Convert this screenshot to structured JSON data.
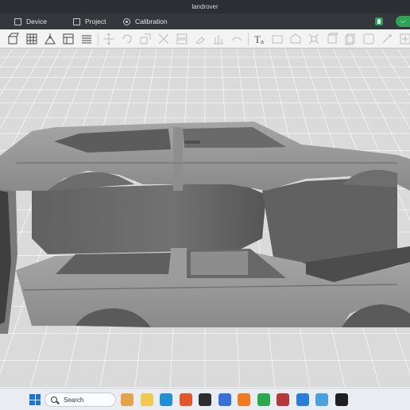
{
  "window": {
    "title": "landrover"
  },
  "menu": {
    "items": [
      {
        "label": "Device",
        "icon": "monitor-icon"
      },
      {
        "label": "Project",
        "icon": "folder-icon"
      },
      {
        "label": "Calibration",
        "icon": "gear-icon"
      }
    ],
    "right_pill_glyph": "⌵"
  },
  "toolbar": {
    "icons": [
      "add-object-icon",
      "grid-icon",
      "import-icon",
      "layout-icon",
      "slice-icon",
      "move-icon",
      "rotate-icon",
      "scale-icon",
      "cut-icon",
      "split-icon",
      "paint-icon",
      "support-icon",
      "seam-icon",
      "text-icon",
      "measure-icon",
      "assembly-icon",
      "arrange-icon",
      "orient-icon",
      "copy-icon",
      "plate-icon",
      "variable-layer-icon",
      "more-icon"
    ]
  },
  "taskbar": {
    "search_label": "Search",
    "apps": [
      "widgets-icon",
      "files-icon",
      "edge-icon",
      "office-icon",
      "terminal-icon",
      "vpn-icon",
      "firefox-icon",
      "spreadsheet-icon",
      "app-icon",
      "photos-icon",
      "store-icon",
      "slicer-icon"
    ]
  },
  "colors": {
    "titlebar": "#2b2e33",
    "menubar": "#34373c",
    "accent_green": "#30a356",
    "viewport_bg": "#dadada",
    "model_light": "#9a9a9a",
    "model_dark": "#555555"
  }
}
